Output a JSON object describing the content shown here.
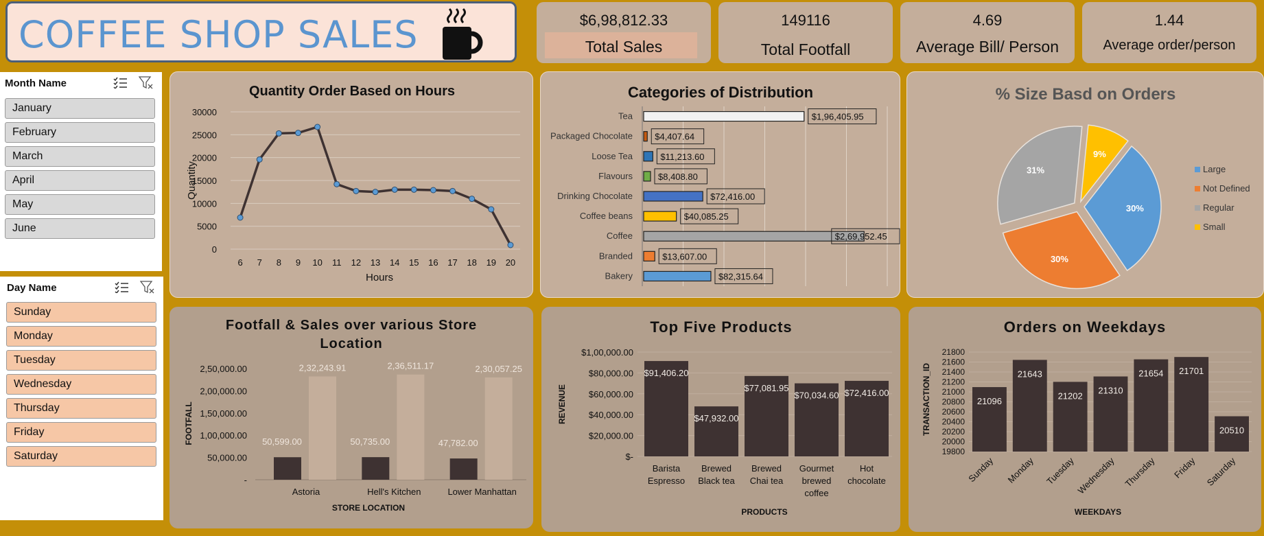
{
  "header": {
    "title": "COFFEE SHOP SALES",
    "mug_icon": "coffee-mug-icon"
  },
  "kpis": [
    {
      "value": "$6,98,812.33",
      "label": "Total Sales"
    },
    {
      "value": "149116",
      "label": "Total Footfall"
    },
    {
      "value": "4.69",
      "label": "Average Bill/ Person"
    },
    {
      "value": "1.44",
      "label": "Average order/person"
    }
  ],
  "month_slicer": {
    "title": "Month Name",
    "items": [
      "January",
      "February",
      "March",
      "April",
      "May",
      "June"
    ]
  },
  "day_slicer": {
    "title": "Day Name",
    "items": [
      "Sunday",
      "Monday",
      "Tuesday",
      "Wednesday",
      "Thursday",
      "Friday",
      "Saturday"
    ]
  },
  "colors": {
    "background": "#c48f08",
    "panel": "#c4ae9b",
    "panel_dark": "#b29f8d",
    "dark_bar": "#3e3232",
    "light_bar": "#c4ae9b",
    "title_blue": "#5b95cf"
  },
  "chart_data": [
    {
      "id": "hours",
      "type": "line",
      "title": "Quantity Order Based on Hours",
      "xlabel": "Hours",
      "ylabel": "Quantity",
      "x": [
        6,
        7,
        8,
        9,
        10,
        11,
        12,
        13,
        14,
        15,
        16,
        17,
        18,
        19,
        20
      ],
      "values": [
        6900,
        19600,
        25300,
        25400,
        26700,
        14200,
        12700,
        12500,
        13000,
        13000,
        12900,
        12700,
        11000,
        8700,
        900
      ],
      "yticks": [
        "30000",
        "25000",
        "20000",
        "15000",
        "10000",
        "5000",
        "0"
      ],
      "ylim": [
        0,
        30000
      ],
      "grid": true
    },
    {
      "id": "categories",
      "type": "bar",
      "orientation": "horizontal",
      "title": "Categories of Distribution",
      "categories": [
        "Tea",
        "Packaged Chocolate",
        "Loose Tea",
        "Flavours",
        "Drinking Chocolate",
        "Coffee beans",
        "Coffee",
        "Branded",
        "Bakery"
      ],
      "values": [
        196405.95,
        4407.64,
        11213.6,
        8408.8,
        72416.0,
        40085.25,
        269952.45,
        13607.0,
        82315.64
      ],
      "labels": [
        "$1,96,405.95",
        "$4,407.64",
        "$11,213.60",
        "$8,408.80",
        "$72,416.00",
        "$40,085.25",
        "$2,69,952.45",
        "$13,607.00",
        "$82,315.64"
      ],
      "colors": [
        "#f2f2f2",
        "#c55a11",
        "#2e75b6",
        "#70ad47",
        "#4472c4",
        "#ffc000",
        "#a5a5a5",
        "#ed7d31",
        "#5b9bd5"
      ],
      "xlim": [
        0,
        300000
      ],
      "grid": true
    },
    {
      "id": "size",
      "type": "pie",
      "title": "% Size Basd on Orders",
      "categories": [
        "Large",
        "Not Defined",
        "Regular",
        "Small"
      ],
      "values": [
        30,
        30,
        31,
        9
      ],
      "labels": [
        "30%",
        "30%",
        "31%",
        "9%"
      ],
      "colors": [
        "#5b9bd5",
        "#ed7d31",
        "#a5a5a5",
        "#ffc000"
      ],
      "legend": "right"
    },
    {
      "id": "store",
      "type": "bar",
      "title": "Footfall  & Sales over various Store Location",
      "xlabel": "STORE LOCATION",
      "ylabel": "FOOTFALL",
      "categories": [
        "Astoria",
        "Hell's Kitchen",
        "Lower Manhattan"
      ],
      "series": [
        {
          "values": [
            50599,
            50735,
            47782
          ],
          "labels": [
            "50,599.00",
            "50,735.00",
            "47,782.00"
          ]
        },
        {
          "values": [
            232243.91,
            236511.17,
            230057.25
          ],
          "labels": [
            "2,32,243.91",
            "2,36,511.17",
            "2,30,057.25"
          ]
        }
      ],
      "yticks": [
        "2,50,000.00",
        "2,00,000.00",
        "1,50,000.00",
        "1,00,000.00",
        "50,000.00",
        "-"
      ],
      "ylim": [
        0,
        250000
      ]
    },
    {
      "id": "products",
      "type": "bar",
      "title": "Top Five Products",
      "xlabel": "PRODUCTS",
      "ylabel": "REVENUE",
      "categories": [
        [
          "Barista",
          "Espresso"
        ],
        [
          "Brewed",
          "Black tea"
        ],
        [
          "Brewed",
          "Chai tea"
        ],
        [
          "Gourmet",
          "brewed",
          "coffee"
        ],
        [
          "Hot",
          "chocolate"
        ]
      ],
      "values": [
        91406.2,
        47932.0,
        77081.95,
        70034.6,
        72416.0
      ],
      "labels": [
        "$91,406.20",
        "$47,932.00",
        "$77,081.95",
        "$70,034.60",
        "$72,416.00"
      ],
      "yticks": [
        "$1,00,000.00",
        "$80,000.00",
        "$60,000.00",
        "$40,000.00",
        "$20,000.00",
        "$-"
      ],
      "ylim": [
        0,
        100000
      ]
    },
    {
      "id": "weekdays",
      "type": "bar",
      "title": "Orders on Weekdays",
      "xlabel": "WEEKDAYS",
      "ylabel": "TRANSACTION_ID",
      "categories": [
        "Sunday",
        "Monday",
        "Tuesday",
        "Wednesday",
        "Thursday",
        "Friday",
        "Saturday"
      ],
      "values": [
        21096,
        21643,
        21202,
        21310,
        21654,
        21701,
        20510
      ],
      "labels": [
        "21096",
        "21643",
        "21202",
        "21310",
        "21654",
        "21701",
        "20510"
      ],
      "yticks": [
        "21800",
        "21600",
        "21400",
        "21200",
        "21000",
        "20800",
        "20600",
        "20400",
        "20200",
        "20000",
        "19800"
      ],
      "ylim": [
        19800,
        21800
      ]
    }
  ]
}
